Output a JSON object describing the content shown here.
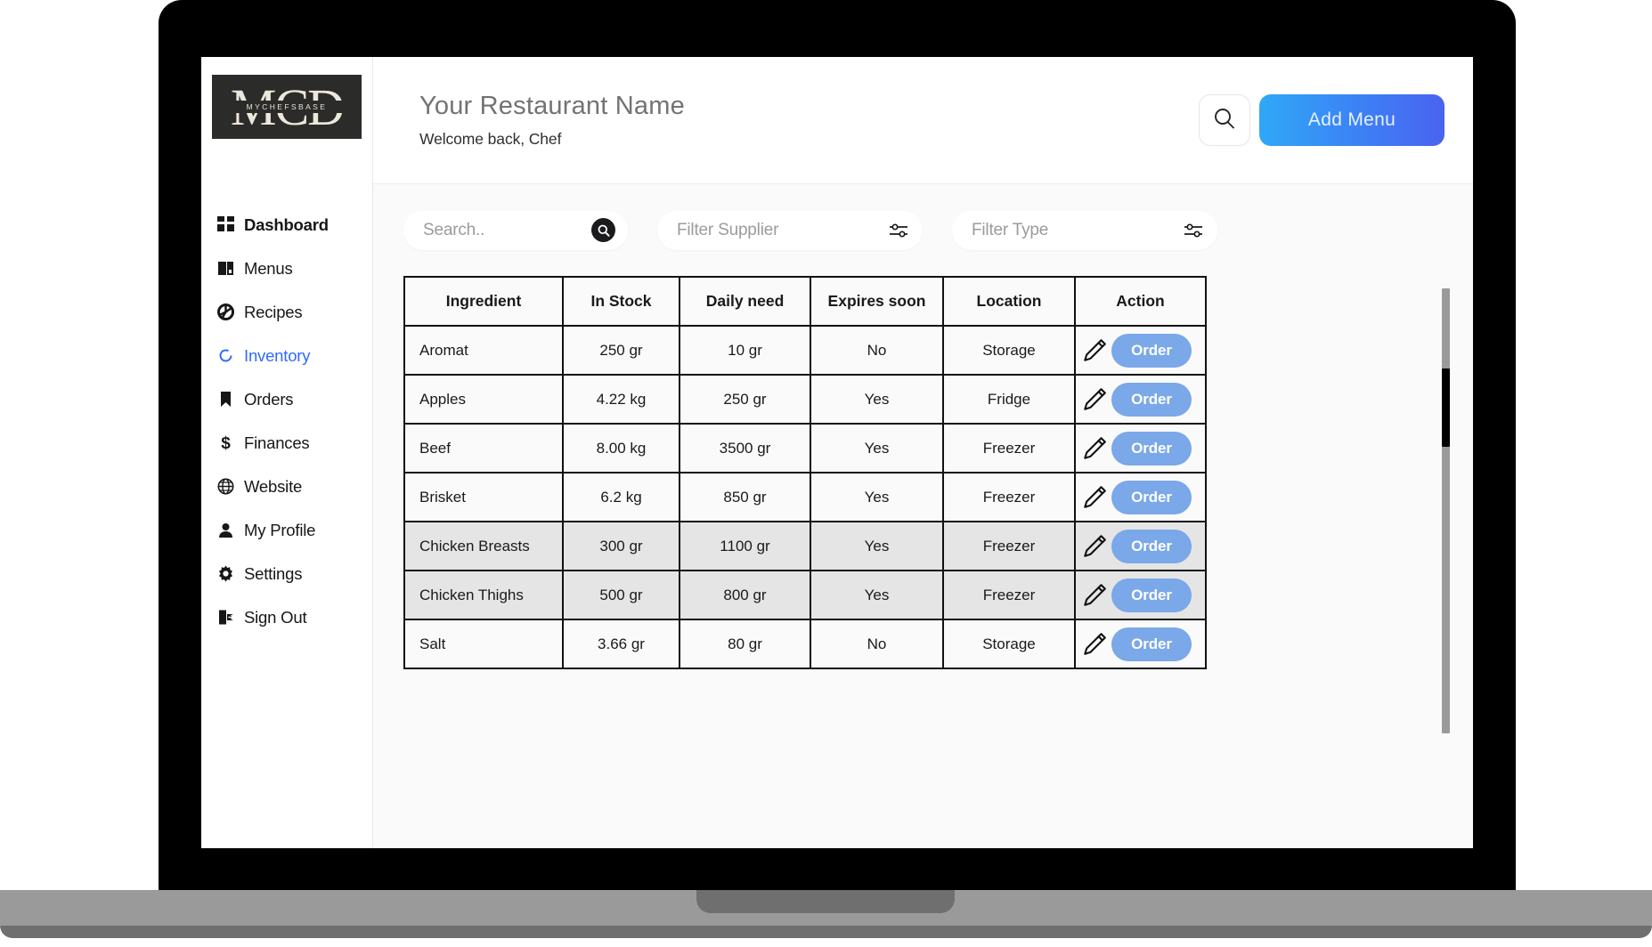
{
  "brand": {
    "logo_letters": "MCD",
    "logo_subtitle": "MYCHEFSBASE"
  },
  "sidebar": {
    "items": [
      {
        "label": "Dashboard",
        "icon": "grid-icon",
        "active": false,
        "bold": true
      },
      {
        "label": "Menus",
        "icon": "book-icon",
        "active": false,
        "bold": false
      },
      {
        "label": "Recipes",
        "icon": "aperture-icon",
        "active": false,
        "bold": false
      },
      {
        "label": "Inventory",
        "icon": "refresh-icon",
        "active": true,
        "bold": false
      },
      {
        "label": "Orders",
        "icon": "bookmark-icon",
        "active": false,
        "bold": false
      },
      {
        "label": "Finances",
        "icon": "dollar-icon",
        "active": false,
        "bold": false
      },
      {
        "label": "Website",
        "icon": "globe-icon",
        "active": false,
        "bold": false
      },
      {
        "label": "My Profile",
        "icon": "person-icon",
        "active": false,
        "bold": false
      },
      {
        "label": "Settings",
        "icon": "gear-icon",
        "active": false,
        "bold": false
      },
      {
        "label": "Sign Out",
        "icon": "sign-out-icon",
        "active": false,
        "bold": false
      }
    ]
  },
  "header": {
    "restaurant_name": "Your Restaurant Name",
    "welcome_text": "Welcome back, Chef",
    "add_menu_label": "Add Menu",
    "search_icon": "search-icon"
  },
  "filters": {
    "search_placeholder": "Search..",
    "supplier_placeholder": "Filter Supplier",
    "type_placeholder": "Filter Type",
    "search_submit_icon": "search-icon",
    "supplier_filter_icon": "sliders-icon",
    "type_filter_icon": "sliders-icon"
  },
  "table": {
    "columns": [
      "Ingredient",
      "In Stock",
      "Daily need",
      "Expires soon",
      "Location",
      "Action"
    ],
    "edit_icon": "pencil-icon",
    "order_label": "Order",
    "rows": [
      {
        "ingredient": "Aromat",
        "in_stock": "250 gr",
        "daily_need": "10 gr",
        "expires_soon": "No",
        "location": "Storage",
        "highlight": false
      },
      {
        "ingredient": "Apples",
        "in_stock": "4.22 kg",
        "daily_need": "250 gr",
        "expires_soon": "Yes",
        "location": "Fridge",
        "highlight": false
      },
      {
        "ingredient": "Beef",
        "in_stock": "8.00 kg",
        "daily_need": "3500 gr",
        "expires_soon": "Yes",
        "location": "Freezer",
        "highlight": false
      },
      {
        "ingredient": "Brisket",
        "in_stock": "6.2 kg",
        "daily_need": "850 gr",
        "expires_soon": "Yes",
        "location": "Freezer",
        "highlight": false
      },
      {
        "ingredient": "Chicken Breasts",
        "in_stock": "300 gr",
        "daily_need": "1100 gr",
        "expires_soon": "Yes",
        "location": "Freezer",
        "highlight": true
      },
      {
        "ingredient": "Chicken Thighs",
        "in_stock": "500 gr",
        "daily_need": "800 gr",
        "expires_soon": "Yes",
        "location": "Freezer",
        "highlight": true
      },
      {
        "ingredient": "Salt",
        "in_stock": "3.66 gr",
        "daily_need": "80 gr",
        "expires_soon": "No",
        "location": "Storage",
        "highlight": false
      }
    ]
  },
  "colors": {
    "accent_blue": "#2f6bff",
    "order_button": "#7aa8e8",
    "add_menu_gradient_start": "#2fa8f7",
    "add_menu_gradient_end": "#4a63f0",
    "logo_background": "#2b2b2a",
    "row_highlight": "#e5e5e5"
  }
}
